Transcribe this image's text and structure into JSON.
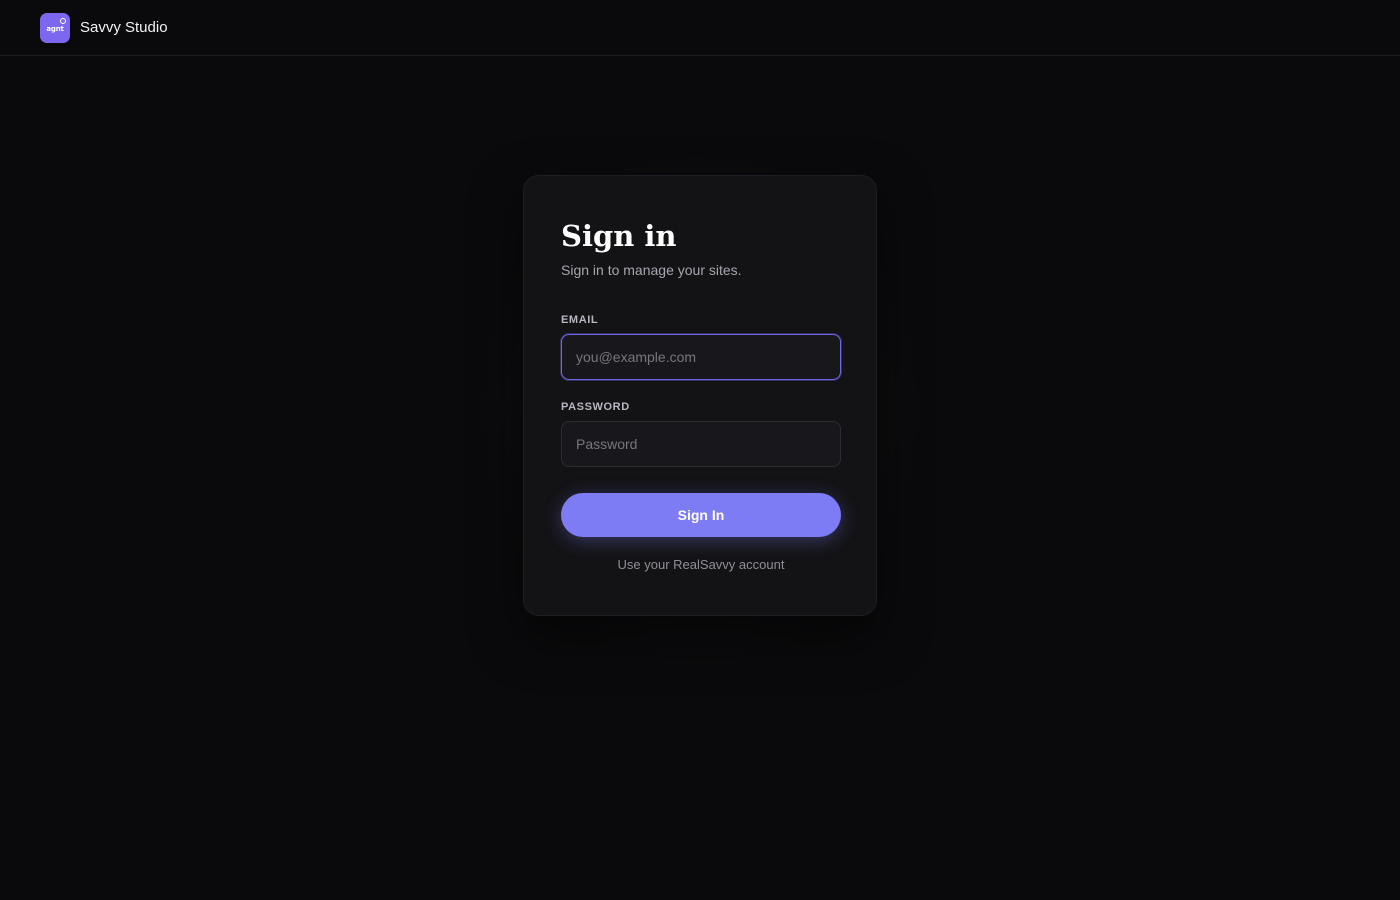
{
  "header": {
    "logo_text": "agnt",
    "brand_name": "Savvy Studio"
  },
  "signin": {
    "title": "Sign in",
    "subtitle": "Sign in to manage your sites.",
    "email_label": "EMAIL",
    "email_placeholder": "you@example.com",
    "email_value": "",
    "password_label": "PASSWORD",
    "password_placeholder": "Password",
    "password_value": "",
    "button_label": "Sign In",
    "footnote": "Use your RealSavvy account"
  },
  "colors": {
    "background": "#0a0a0c",
    "card": "#131316",
    "accent": "#7d7cf4",
    "logo": "#7c68f0",
    "focus_ring": "#6f66e8"
  }
}
